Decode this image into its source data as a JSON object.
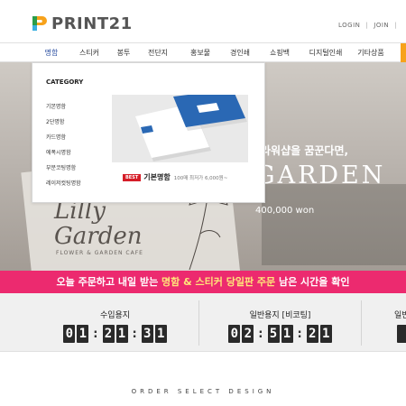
{
  "header": {
    "logo_text": "PRINT21",
    "login": "LOGIN",
    "separator": "|",
    "join": "JOIN",
    "trailing_separator": "|"
  },
  "nav": {
    "items": [
      {
        "label": "명함",
        "active": true
      },
      {
        "label": "스티커",
        "active": false
      },
      {
        "label": "봉투",
        "active": false
      },
      {
        "label": "전단지",
        "active": false
      },
      {
        "label": "홍보물",
        "active": false
      },
      {
        "label": "경인쇄",
        "active": false
      },
      {
        "label": "쇼핑백",
        "active": false
      },
      {
        "label": "디지털인쇄",
        "active": false
      },
      {
        "label": "기타상품",
        "active": false
      }
    ]
  },
  "dropdown": {
    "title": "CATEGORY",
    "items": [
      "기본명함",
      "2단명함",
      "카드명함",
      "에폭시명함",
      "부분코팅명함",
      "레이저컷팅명함"
    ],
    "featured": {
      "badge": "BEST",
      "name": "기본명함",
      "price": "100매 최저가 6,000원~"
    }
  },
  "hero": {
    "headline": "라워샵을 꿈꾼다면,",
    "title": "GARDEN",
    "price": "400,000 won",
    "card_line1": "Lilly",
    "card_line2": "Garden",
    "card_sub": "FLOWER & GARDEN CAFE"
  },
  "banner": {
    "part1": "오늘 주문하고 내일 받는 ",
    "highlight": "명함 & 스티커 당일판 주문",
    "part2": " 남은 시간을 확인"
  },
  "countdown": {
    "blocks": [
      {
        "label": "수입용지",
        "hh": "01",
        "mm": "21",
        "ss": "31"
      },
      {
        "label": "일반용지 [비코팅]",
        "hh": "02",
        "mm": "51",
        "ss": "21"
      },
      {
        "label": "일반",
        "hh": "",
        "mm": "",
        "ss": ""
      }
    ]
  },
  "section": {
    "order_heading": "ORDER SELECT DESIGN"
  },
  "colors": {
    "accent_blue": "#2a4ea0",
    "banner_pink": "#ec2a6f",
    "highlight_yellow": "#ffe57a",
    "best_red": "#d51d28",
    "nav_orange": "#f7a21b"
  }
}
